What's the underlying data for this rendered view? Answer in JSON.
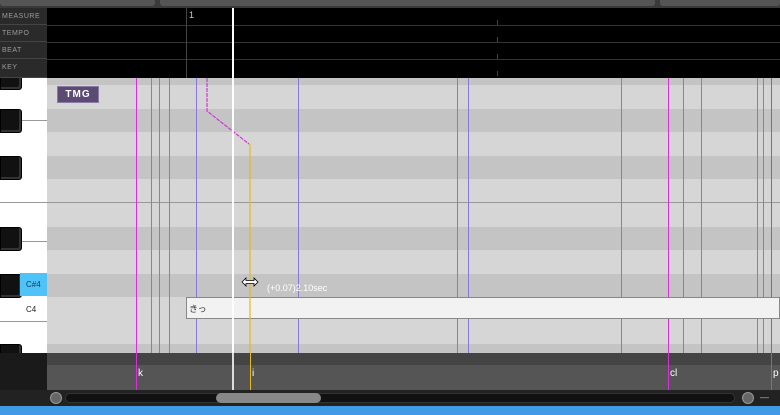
{
  "ruler_labels": [
    "MEASURE",
    "TEMPO",
    "BEAT",
    "KEY"
  ],
  "measure_number": "1",
  "keys": {
    "cs4_label": "C#4",
    "c4_label": "C4"
  },
  "track_badge": "TMG",
  "note": {
    "lyric": "きっ"
  },
  "tooltip": "(+0.07)2.10sec",
  "phonemes": [
    "k",
    "i",
    "cl",
    "p"
  ],
  "scrollbar": {
    "right_label": "— —"
  },
  "colors": {
    "phoneme_line": "#d633d6",
    "boundary_line": "#8877dd",
    "playhead": "#ffffff",
    "vibrato_line": "#e8b820",
    "key_highlight": "#4fc3f7"
  }
}
